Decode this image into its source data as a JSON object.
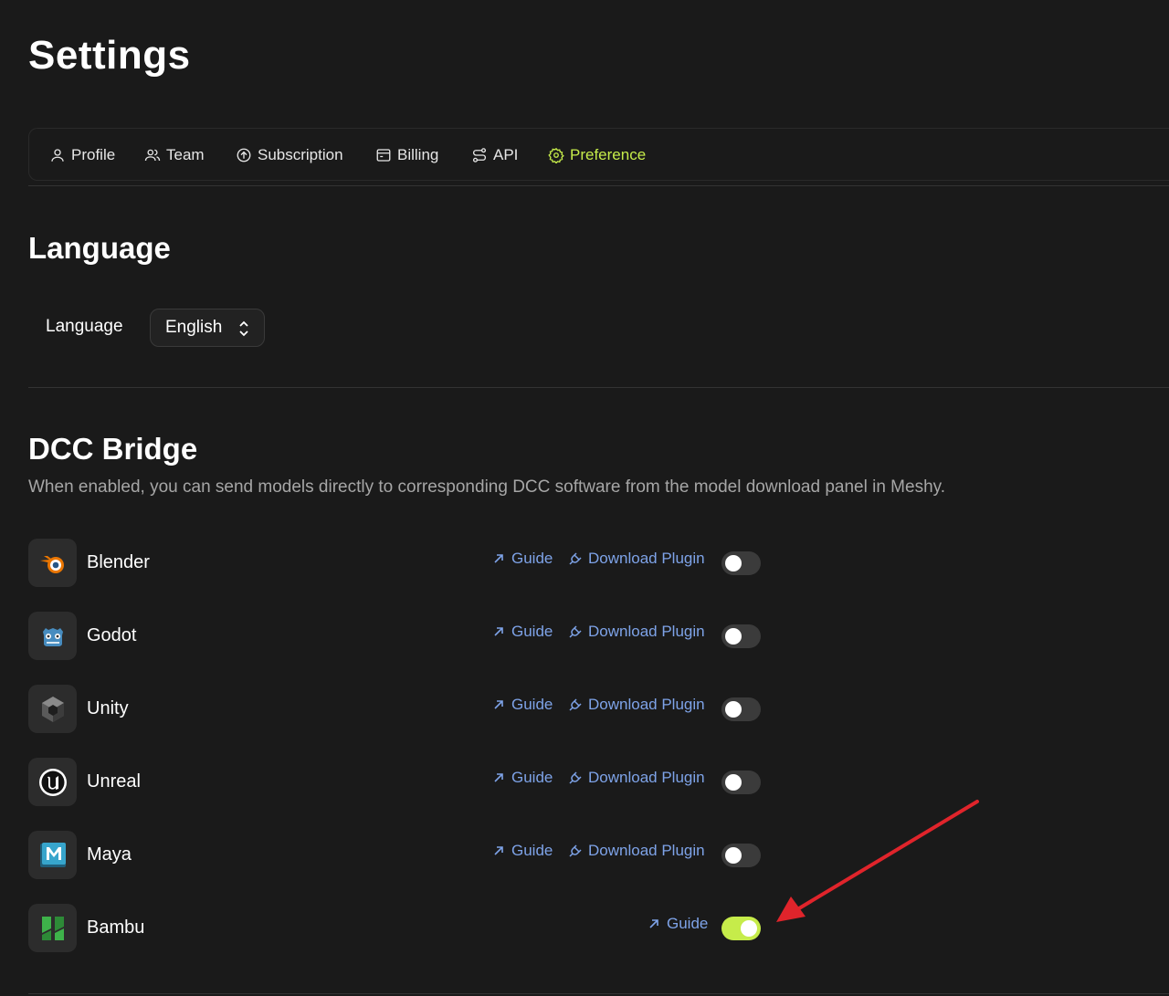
{
  "page": {
    "title": "Settings"
  },
  "tabs": [
    {
      "label": "Profile",
      "icon": "user-icon",
      "active": false
    },
    {
      "label": "Team",
      "icon": "users-icon",
      "active": false
    },
    {
      "label": "Subscription",
      "icon": "upgrade-circle-icon",
      "active": false
    },
    {
      "label": "Billing",
      "icon": "billing-icon",
      "active": false
    },
    {
      "label": "API",
      "icon": "api-route-icon",
      "active": false
    },
    {
      "label": "Preference",
      "icon": "gear-icon",
      "active": true
    }
  ],
  "language_section": {
    "title": "Language",
    "label": "Language",
    "selected": "English"
  },
  "dcc_section": {
    "title": "DCC Bridge",
    "description": "When enabled, you can send models directly to corresponding DCC software from the model download panel in Meshy.",
    "guide_label": "Guide",
    "download_label": "Download Plugin",
    "items": [
      {
        "name": "Blender",
        "icon": "blender-icon",
        "has_download": true,
        "enabled": false
      },
      {
        "name": "Godot",
        "icon": "godot-icon",
        "has_download": true,
        "enabled": false
      },
      {
        "name": "Unity",
        "icon": "unity-icon",
        "has_download": true,
        "enabled": false
      },
      {
        "name": "Unreal",
        "icon": "unreal-icon",
        "has_download": true,
        "enabled": false
      },
      {
        "name": "Maya",
        "icon": "maya-icon",
        "has_download": true,
        "enabled": false
      },
      {
        "name": "Bambu",
        "icon": "bambu-icon",
        "has_download": false,
        "enabled": true
      }
    ]
  },
  "colors": {
    "background": "#1a1a1a",
    "accent": "#c6ec4a",
    "link": "#7ea3e8",
    "annotation_arrow": "#e0242b"
  }
}
